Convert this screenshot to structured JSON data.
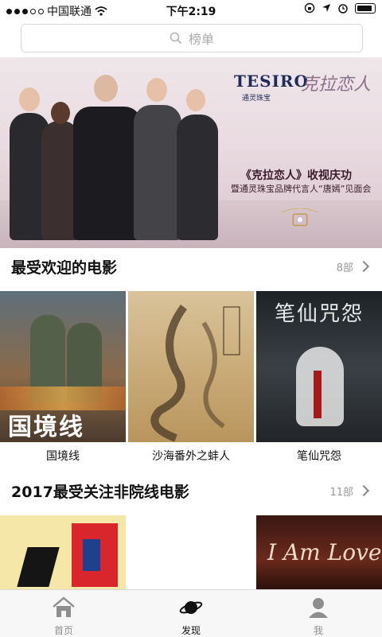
{
  "status_bar": {
    "carrier": "中国联通",
    "time": "下午2:19"
  },
  "search": {
    "placeholder": "榜单"
  },
  "banner": {
    "brand": "TESIRO",
    "brand_sub": "通灵珠宝",
    "script_title": "克拉恋人",
    "caption_line1": "《克拉恋人》收视庆功",
    "caption_line2": "暨通灵珠宝品牌代言人“唐嫣”见面会"
  },
  "sections": [
    {
      "title": "最受欢迎的电影",
      "count": "8部",
      "movies": [
        {
          "name": "国境线",
          "poster_text": "国境线"
        },
        {
          "name": "沙海番外之蚌人",
          "poster_text": ""
        },
        {
          "name": "笔仙咒怨",
          "poster_text": "笔仙咒怨"
        }
      ]
    },
    {
      "title": "2017最受关注非院线电影",
      "count": "11部",
      "movies": [
        {
          "name": "",
          "poster_text": ""
        },
        {
          "name": "",
          "poster_text": ""
        },
        {
          "name": "",
          "poster_text": "I Am Love"
        }
      ]
    }
  ],
  "tabbar": {
    "tabs": [
      {
        "label": "首页",
        "icon": "home-icon"
      },
      {
        "label": "发现",
        "icon": "planet-icon"
      },
      {
        "label": "我",
        "icon": "person-icon"
      }
    ],
    "active_index": 1
  },
  "colors": {
    "tab_active": "#111111",
    "tab_inactive": "#8e8e8e"
  }
}
